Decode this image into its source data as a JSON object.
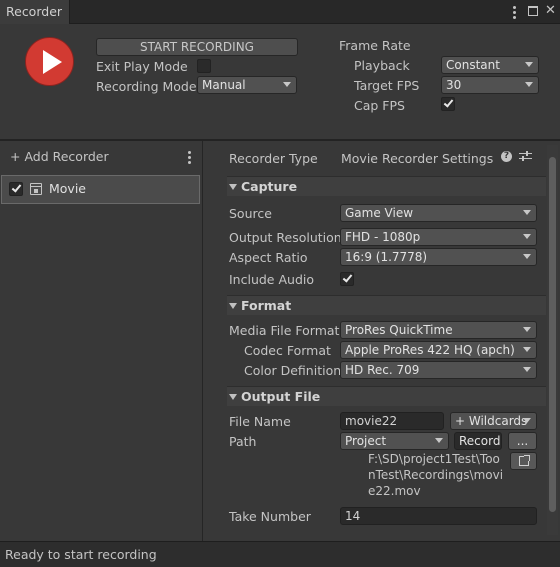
{
  "window": {
    "tab_title": "Recorder"
  },
  "top": {
    "start_button": "START RECORDING",
    "exit_play_mode_label": "Exit Play Mode",
    "exit_play_mode_checked": false,
    "recording_mode_label": "Recording Mode",
    "recording_mode_value": "Manual",
    "frame_rate_title": "Frame Rate",
    "playback_label": "Playback",
    "playback_value": "Constant",
    "target_fps_label": "Target FPS",
    "target_fps_value": "30",
    "cap_fps_label": "Cap FPS",
    "cap_fps_checked": true
  },
  "left_panel": {
    "add_recorder": "+ Add Recorder",
    "recorders": [
      {
        "name": "Movie",
        "enabled": true
      }
    ]
  },
  "settings": {
    "recorder_type_label": "Recorder Type",
    "recorder_type_value": "Movie Recorder Settings",
    "capture": {
      "title": "Capture",
      "source_label": "Source",
      "source_value": "Game View",
      "output_resolution_label": "Output Resolution",
      "output_resolution_value": "FHD - 1080p",
      "aspect_ratio_label": "Aspect Ratio",
      "aspect_ratio_value": "16:9 (1.7778)",
      "include_audio_label": "Include Audio",
      "include_audio_checked": true
    },
    "format": {
      "title": "Format",
      "media_file_format_label": "Media File Format",
      "media_file_format_value": "ProRes QuickTime",
      "codec_format_label": "Codec Format",
      "codec_format_value": "Apple ProRes 422 HQ (apch)",
      "color_definition_label": "Color Definition",
      "color_definition_value": "HD Rec. 709"
    },
    "output_file": {
      "title": "Output File",
      "file_name_label": "File Name",
      "file_name_value": "movie22",
      "wildcards_label": "+ Wildcards",
      "path_label": "Path",
      "path_root_value": "Project",
      "path_field_value": "Record",
      "browse_label": "...",
      "full_path_lines": [
        "F:\\SD\\project1Test\\Too",
        "nTest\\Recordings\\movi",
        "e22.mov"
      ],
      "take_number_label": "Take Number",
      "take_number_value": "14"
    }
  },
  "status_bar": {
    "text": "Ready to start recording"
  }
}
